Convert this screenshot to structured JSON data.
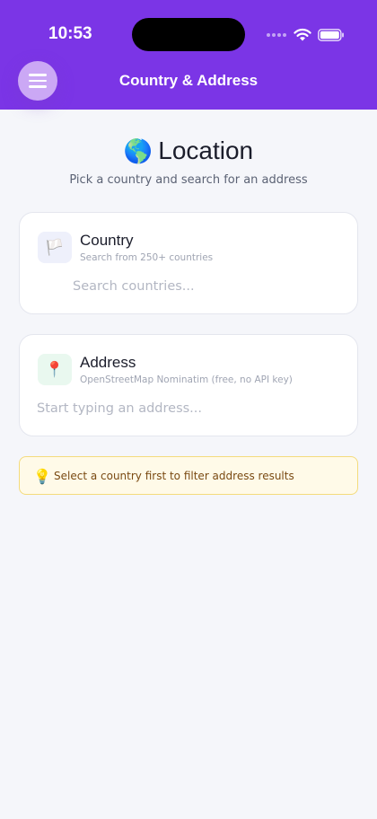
{
  "status_bar": {
    "time": "10:53"
  },
  "header": {
    "title": "Country & Address"
  },
  "hero": {
    "emoji": "🌎",
    "title": "Location",
    "subtitle": "Pick a country and search for an address"
  },
  "country_card": {
    "icon": "🏳️",
    "icon_name": "white-flag-icon",
    "title": "Country",
    "subtitle": "Search from 250+ countries",
    "input_placeholder": "Search countries...",
    "input_value": ""
  },
  "address_card": {
    "icon": "📍",
    "icon_name": "pin-icon",
    "title": "Address",
    "subtitle": "OpenStreetMap Nominatim (free, no API key)",
    "input_placeholder": "Start typing an address...",
    "input_value": ""
  },
  "tip": {
    "icon": "💡",
    "text": "Select a country first to filter address results"
  },
  "colors": {
    "header_bg": "#7b35e6",
    "menu_button_bg": "#cba8f5",
    "page_bg": "#f5f6fa",
    "tip_bg": "#fffae8",
    "tip_border": "#f4db7c"
  }
}
